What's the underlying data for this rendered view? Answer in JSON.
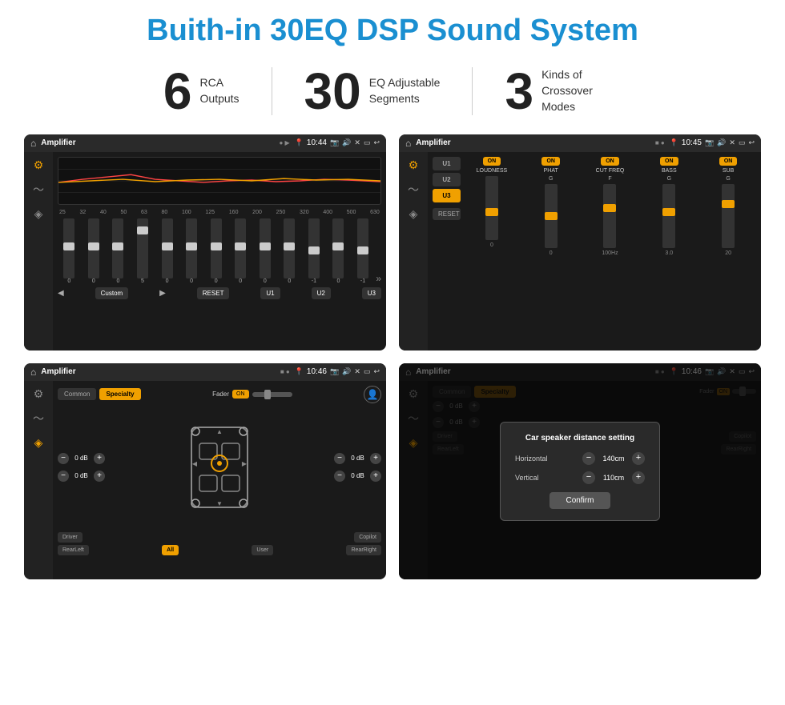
{
  "page": {
    "title": "Buith-in 30EQ DSP Sound System",
    "background": "#ffffff"
  },
  "stats": [
    {
      "number": "6",
      "label_line1": "RCA",
      "label_line2": "Outputs"
    },
    {
      "number": "30",
      "label_line1": "EQ Adjustable",
      "label_line2": "Segments"
    },
    {
      "number": "3",
      "label_line1": "Kinds of",
      "label_line2": "Crossover Modes"
    }
  ],
  "screens": [
    {
      "id": "eq-screen",
      "app_name": "Amplifier",
      "time": "10:44",
      "type": "equalizer",
      "eq_labels": [
        "25",
        "32",
        "40",
        "50",
        "63",
        "80",
        "100",
        "125",
        "160",
        "200",
        "250",
        "320",
        "400",
        "500",
        "630"
      ],
      "eq_values": [
        "0",
        "0",
        "0",
        "5",
        "0",
        "0",
        "0",
        "0",
        "0",
        "0",
        "0",
        "-1",
        "0",
        "-1"
      ],
      "preset_name": "Custom",
      "buttons": [
        "RESET",
        "U1",
        "U2",
        "U3"
      ]
    },
    {
      "id": "crossover-screen",
      "app_name": "Amplifier",
      "time": "10:45",
      "type": "crossover",
      "presets": [
        "U1",
        "U2",
        "U3"
      ],
      "active_preset": "U3",
      "columns": [
        {
          "label": "LOUDNESS",
          "on": true
        },
        {
          "label": "PHAT",
          "on": true
        },
        {
          "label": "CUT FREQ",
          "on": true
        },
        {
          "label": "BASS",
          "on": true
        },
        {
          "label": "SUB",
          "on": true
        }
      ]
    },
    {
      "id": "speaker-screen",
      "app_name": "Amplifier",
      "time": "10:46",
      "type": "speaker",
      "tabs": [
        "Common",
        "Specialty"
      ],
      "active_tab": "Specialty",
      "fader_label": "Fader",
      "fader_on": true,
      "volume_rows": [
        {
          "value": "0 dB"
        },
        {
          "value": "0 dB"
        },
        {
          "value": "0 dB"
        },
        {
          "value": "0 dB"
        }
      ],
      "bottom_buttons": [
        "Driver",
        "",
        "Copilot",
        "RearLeft",
        "All",
        "",
        "User",
        "RearRight"
      ]
    },
    {
      "id": "speaker-dialog-screen",
      "app_name": "Amplifier",
      "time": "10:46",
      "type": "speaker-dialog",
      "tabs": [
        "Common",
        "Specialty"
      ],
      "active_tab": "Specialty",
      "dialog": {
        "title": "Car speaker distance setting",
        "fields": [
          {
            "label": "Horizontal",
            "value": "140cm"
          },
          {
            "label": "Vertical",
            "value": "110cm"
          }
        ],
        "confirm_label": "Confirm"
      },
      "volume_rows": [
        {
          "value": "0 dB"
        },
        {
          "value": "0 dB"
        }
      ],
      "bottom_buttons": [
        "Driver",
        "Copilot",
        "RearLeft",
        "RearRight"
      ]
    }
  ]
}
